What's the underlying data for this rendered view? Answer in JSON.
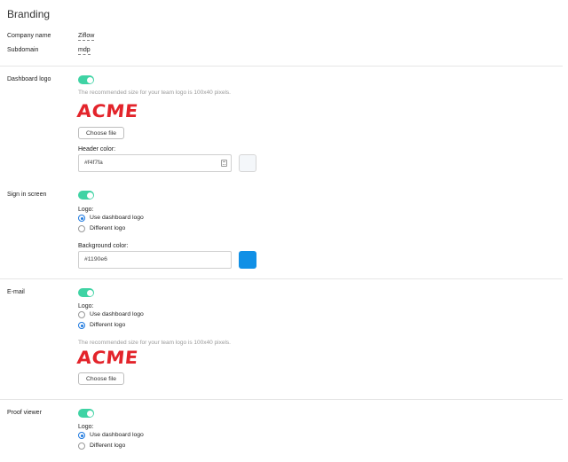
{
  "page": {
    "title": "Branding"
  },
  "company": {
    "label": "Company name",
    "value": "Ziflow"
  },
  "subdomain": {
    "label": "Subdomain",
    "value": "mdp"
  },
  "dashboard_logo": {
    "label": "Dashboard logo",
    "enabled": true,
    "hint": "The recommended size for your team logo is 100x40 pixels.",
    "logo_text": "ACME",
    "choose_file": "Choose file",
    "header_color_label": "Header color:",
    "header_color_value": "#f4f7fa",
    "header_color_swatch": "#f4f7fa"
  },
  "sign_in_screen": {
    "label": "Sign in screen",
    "enabled": true,
    "logo_label": "Logo:",
    "options": [
      "Use dashboard logo",
      "Different logo"
    ],
    "selected": 0,
    "background_color_label": "Background color:",
    "background_color_value": "#1190e6",
    "background_color_swatch": "#1190e6"
  },
  "email": {
    "label": "E-mail",
    "enabled": true,
    "logo_label": "Logo:",
    "options": [
      "Use dashboard logo",
      "Different logo"
    ],
    "selected": 1,
    "hint": "The recommended size for your team logo is 100x40 pixels.",
    "logo_text": "ACME",
    "choose_file": "Choose file"
  },
  "proof_viewer": {
    "label": "Proof viewer",
    "enabled": true,
    "logo_label": "Logo:",
    "options": [
      "Use dashboard logo",
      "Different logo"
    ],
    "selected": 0
  },
  "colors": {
    "toggle_on": "#3fd3a4",
    "radio_selected": "#1f7ae0",
    "logo_red": "#e3242b"
  }
}
